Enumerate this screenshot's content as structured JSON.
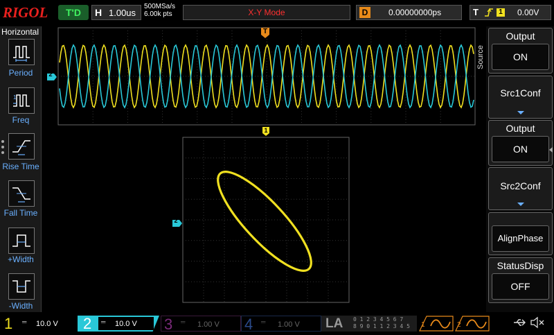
{
  "header": {
    "brand": "RIGOL",
    "run_status": "T'D",
    "horizontal_key": "H",
    "timebase": "1.00us",
    "sample_rate": "500MSa/s",
    "memory_depth": "6.00k pts",
    "mode": "X-Y Mode",
    "delay_key": "D",
    "delay": "0.00000000ps",
    "trigger_key": "T",
    "trigger_source": "1",
    "trigger_level": "0.00V"
  },
  "left_menu": {
    "title": "Horizontal",
    "items": [
      {
        "label": "Period",
        "icon": "period-icon"
      },
      {
        "label": "Freq",
        "icon": "frequency-icon"
      },
      {
        "label": "Rise Time",
        "icon": "rise-time-icon"
      },
      {
        "label": "Fall Time",
        "icon": "fall-time-icon"
      },
      {
        "label": "+Width",
        "icon": "positive-width-icon"
      },
      {
        "label": "-Width",
        "icon": "negative-width-icon"
      }
    ]
  },
  "right_menu": {
    "side_label": "Source",
    "items": [
      {
        "header": "Output",
        "value": "ON"
      },
      {
        "label": "Src1Conf"
      },
      {
        "header": "Output",
        "value": "ON"
      },
      {
        "label": "Src2Conf"
      },
      {
        "label": "AlignPhase"
      },
      {
        "header": "StatusDisp",
        "value": "OFF"
      }
    ]
  },
  "markers": {
    "trigger_marker": "T",
    "ch1_marker": "1",
    "ch2_marker": "2",
    "ch2_xy_marker": "2"
  },
  "channels": [
    {
      "num": "1",
      "value": "10.0 V",
      "color": "#f0e020",
      "active": true
    },
    {
      "num": "2",
      "value": "10.0 V",
      "color": "#29c8d8",
      "active": true
    },
    {
      "num": "3",
      "value": "1.00 V",
      "color": "#c030c0",
      "active": false
    },
    {
      "num": "4",
      "value": "1.00 V",
      "color": "#3070ff",
      "active": false
    }
  ],
  "bottom": {
    "la_label": "LA",
    "la_digits_top": "0 1 2 3   4 5 6 7",
    "la_digits_bottom": "8 9 0 1  1 2 3 4 5",
    "source1": "1",
    "source2": "2"
  },
  "colors": {
    "ch1": "#f0e020",
    "ch2": "#29c8d8",
    "accent_orange": "#e88a1a",
    "menu_blue": "#6ab0ff"
  }
}
